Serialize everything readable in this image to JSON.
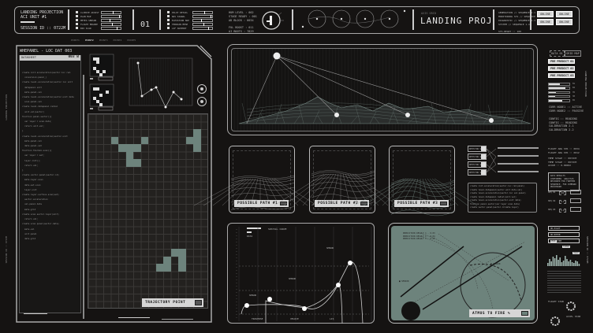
{
  "header": {
    "title": "LANDING PROJECTION",
    "unit": "ACI UNIT #1",
    "session": "SESSION ID :: 0722M",
    "counter": "01",
    "sliders_a": [
      "CLIMATE ADJUST",
      "PLAN MAP",
      "METEO SENSOR",
      "FLIGHT ENGINE",
      "BIO SCAN"
    ],
    "sliders_b": [
      "PILOT DETAIL",
      "NAV SIGNAL",
      "ELEVATION MAP",
      "TERRAIN MESH",
      "LIF SUPPORT"
    ],
    "stats": [
      "HUM LEVEL : 002",
      "STAGE READY : 001",
      "AD BLOCK : 0034",
      "FUL BOOST : 011",
      "AI BOOTS : 7829"
    ],
    "brand": "LANDING PROJ",
    "brand_meta": [
      "AXIS",
      "GRID"
    ],
    "info_list": [
      "GENERATION // SEQUENCE 1.1",
      "MONITORING SYS // SEQUENCE 1.2",
      "DIAGNOSTIC // SEQUENCE 1.3",
      "SYSTEM // SEQUENCE 1.4",
      "SYS.READY :: 100"
    ],
    "buttons": [
      "ONLINE",
      "ONLINE",
      "ONLINE",
      "ONLINE"
    ]
  },
  "tabs": [
    "POINT1",
    "POINT2",
    "POINT3",
    "POINT4",
    "POINT5"
  ],
  "left_panel": {
    "title": "WHEPANEL - LOC DAT 003",
    "code_header": "DATASHEET",
    "code_id": "003 B",
    "code_lines": [
      "create init.acceleration(sector.loc rad.",
      "  conversion.panel_)",
      "create level.acceleration(sector.loc unit",
      "  datapanel.unit",
      "  meta.panel.vel",
      "create level.acceleration(sector.unit data",
      "  scan.panel.vel",
      "create level.datapanel.radial",
      "  unit.vel(sector)",
      "function panel.sector(){",
      "  var layer = scan.data;",
      "  return unit.vel;",
      "}",
      "create level.acceleration(sector.unit",
      "  meta.panel.vel",
      "  data.panel.set",
      "function thermal.scan(){",
      "  var layer = set;",
      "  layer.init();",
      "  return vel;",
      "}",
      "create vector.panel(sector.id)",
      "  meta.layer.scan",
      "  data.set.scan",
      "  layer.unit",
      "create layer.surface.scan(set)",
      "  sector.acceleration",
      "  vel.panel.data",
      "  meta.grid",
      "create scan.sector.layer(unit)",
      "  return vel;",
      "create scan.panel(sector.data)",
      "  meta.vel",
      "  unit.panel",
      "  data.grid"
    ],
    "chart_labels": [
      "SENSOR",
      "DATA",
      "FLOW",
      "AXIS"
    ],
    "y_labels": [
      "10:00",
      "08:00",
      "06:00",
      "04:00",
      "02:00"
    ],
    "side_labels": [
      "STATUS",
      "VALUE",
      "DATA"
    ],
    "trajectory_label": "TRAJECTORY POINT",
    "vertical_left": "LANDING PROJECTION",
    "vertical_left2": "SESSION ID :: 0722M"
  },
  "right_col": {
    "tags": [
      "DATA 01",
      "GRID MAP"
    ],
    "predicts": [
      "PRE PREDICT 01",
      "PRE PREDICT 02",
      "PRE PREDICT 03"
    ],
    "bars": [
      0.55,
      0.82,
      0.35,
      0.3,
      0.65
    ],
    "bar_vals": [
      "55",
      "82",
      "35",
      "30",
      "65"
    ],
    "status": [
      "CURR NODE1 :: ACTIVE",
      "CURR NODE2 :: PASSIVE"
    ],
    "nodes": [
      "CONFIG :: READING",
      "CONFIG :: READING",
      "CALIBRATION 2.1",
      "CALIBRATION 2.2"
    ],
    "vertical": "LANDING PROJECTION"
  },
  "paths": [
    "POSSIBLE PATH #1",
    "POSSIBLE PATH #2",
    "POSSIBLE PATH #3"
  ],
  "links": [
    "DETECTOR SET",
    "DETECTOR SET",
    "DETECTOR SET",
    "DETECTOR SET"
  ],
  "log_lines": [
    "create init.acceleration(sector.loc rad.panel)",
    "create level.datapanel(sector.unit data.vel)",
    "create level.acceleration(sector.loc vel.panel)",
    "create level.datapanel.radial(unit.vel)",
    "create level.acceleration(sector.unit data)",
    "function panel.sector(var layer scan.data)",
    "create vector.panel(sector.id meta.layer)"
  ],
  "lower_right": {
    "stats": [
      "FLIGHT ANG STR :: 0034",
      "FLIGHT ANG STR :: 0012",
      "TEMP STAGE :: 0072CM",
      "TEMP STAGE :: 0072CM",
      "ACCUM :: 0.00002"
    ],
    "notice": "DATA RESULTS CONFIRMED. ANALYSIS RECORDED FOR FURTHER SEQUENCE. FOR COMMAND PROCEDURE.",
    "seqs": [
      "SEQ 01",
      "SEQ 02",
      "SEQ 03"
    ],
    "seq_vals": [
      "220",
      "0.5",
      "0.8"
    ],
    "buttons": [
      "OK.PILOT",
      "OK.ROTOR",
      "OK.SYSTEM"
    ],
    "peaks": [
      "PEAK",
      "SIGNAL",
      "TRACE"
    ],
    "vertical": "SESSION ID :: 0722M",
    "gauge_labels": [
      "FLIGHT STAB",
      "ACCEL STAB"
    ]
  },
  "trend_chart": {
    "title": "SPATIAL CURVE",
    "subtitle": "DATA",
    "x_labels": [
      "TRAVERSE",
      "VELOCE",
      "LIS"
    ],
    "notes": [
      "SENSOR",
      "SENSOR",
      "SENSOR"
    ]
  },
  "target_panel": {
    "labels": [
      "PREDICTION RESULT 1 - 0.03",
      "PREDICTION RESULT 2 - 0.04",
      "PREDICTION RESULT 3 - 0.05"
    ],
    "markers": [
      "SENSOR",
      "SENSOR"
    ],
    "status": "ATMOS TO FIRE %"
  }
}
